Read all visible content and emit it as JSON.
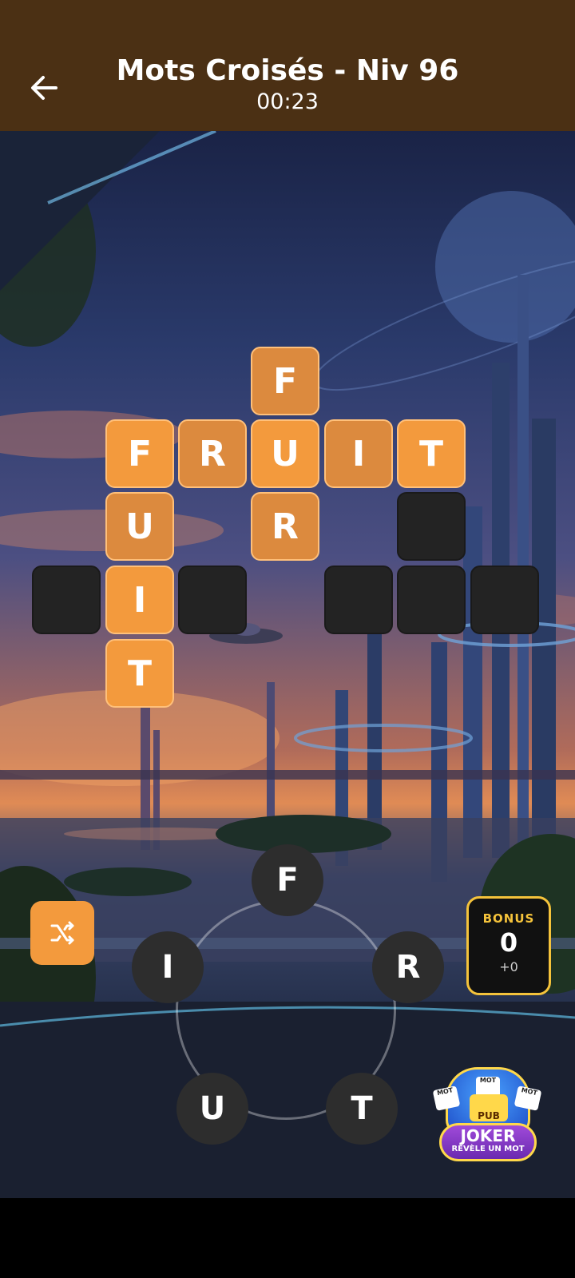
{
  "header": {
    "title": "Mots Croisés - Niv 96",
    "timer": "00:23"
  },
  "grid": {
    "cells": [
      {
        "letter": "F",
        "state": "filled"
      },
      {
        "letter": "F",
        "state": "filled"
      },
      {
        "letter": "R",
        "state": "filled"
      },
      {
        "letter": "U",
        "state": "filled"
      },
      {
        "letter": "I",
        "state": "filled"
      },
      {
        "letter": "T",
        "state": "filled"
      },
      {
        "letter": "U",
        "state": "filled"
      },
      {
        "letter": "R",
        "state": "filled"
      },
      {
        "letter": "",
        "state": "empty"
      },
      {
        "letter": "",
        "state": "empty"
      },
      {
        "letter": "I",
        "state": "filled"
      },
      {
        "letter": "",
        "state": "empty"
      },
      {
        "letter": "",
        "state": "empty"
      },
      {
        "letter": "",
        "state": "empty"
      },
      {
        "letter": "",
        "state": "empty"
      },
      {
        "letter": "T",
        "state": "filled"
      }
    ]
  },
  "wheel": {
    "letters": [
      "F",
      "I",
      "R",
      "U",
      "T"
    ]
  },
  "bonus": {
    "label": "BONUS",
    "count": "0",
    "plus": "+0"
  },
  "joker": {
    "title": "JOKER",
    "subtitle": "RÉVÈLE UN MOT",
    "pub": "PUB",
    "mini1": "MOT",
    "mini2": "MOT",
    "mini3": "MOT"
  },
  "colors": {
    "header_bg": "#4b3014",
    "tile_orange": "#f39a3d",
    "tile_empty": "#232323",
    "bonus_border": "#f5c33b"
  }
}
